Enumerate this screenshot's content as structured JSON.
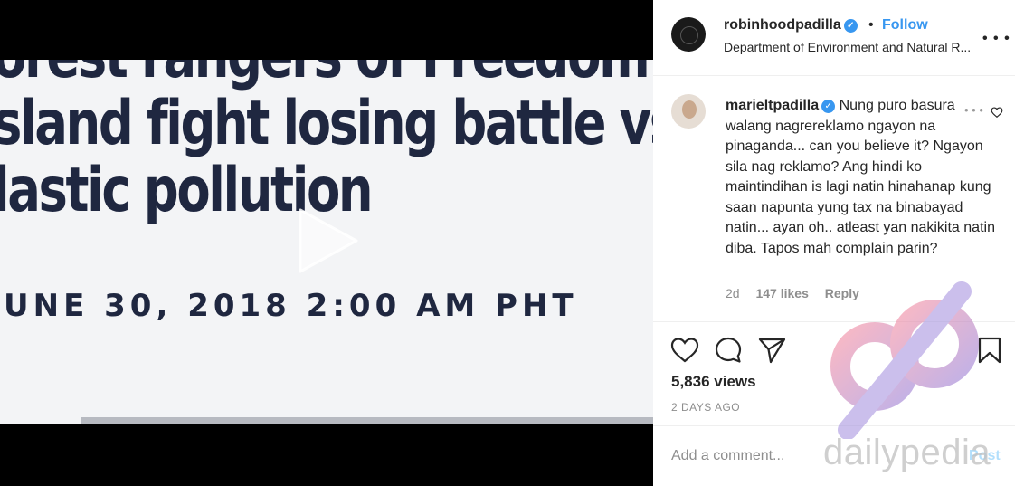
{
  "video": {
    "headline_lines": [
      "orest rangers of Freedom",
      "sland fight losing battle vs",
      "lastic pollution"
    ],
    "dateline": "UNE 30, 2018 2:00 AM PHT",
    "play_icon": "play-icon"
  },
  "post": {
    "username": "robinhoodpadilla",
    "dot": "•",
    "follow_label": "Follow",
    "location": "Department of Environment and Natural R...",
    "more_icon": "more-options-icon"
  },
  "comment": {
    "username": "marieltpadilla",
    "text": "Nung puro basura walang nagrereklamo ngayon na pinaganda... can you believe it? Ngayon sila nag reklamo? Ang hindi ko maintindihan is lagi natin hinahanap kung saan napunta yung tax na binabayad natin... ayan oh.. atleast yan nakikita natin diba. Tapos mah complain parin?",
    "age": "2d",
    "likes": "147 likes",
    "reply": "Reply"
  },
  "stats": {
    "views": "5,836 views",
    "posted": "2 DAYS AGO"
  },
  "composer": {
    "placeholder": "Add a comment...",
    "post_label": "Post"
  },
  "watermark": {
    "text": "dailypedia"
  },
  "colors": {
    "accent": "#3897f0",
    "text": "#262626",
    "muted": "#8e8e8e",
    "headline": "#1f2740"
  }
}
